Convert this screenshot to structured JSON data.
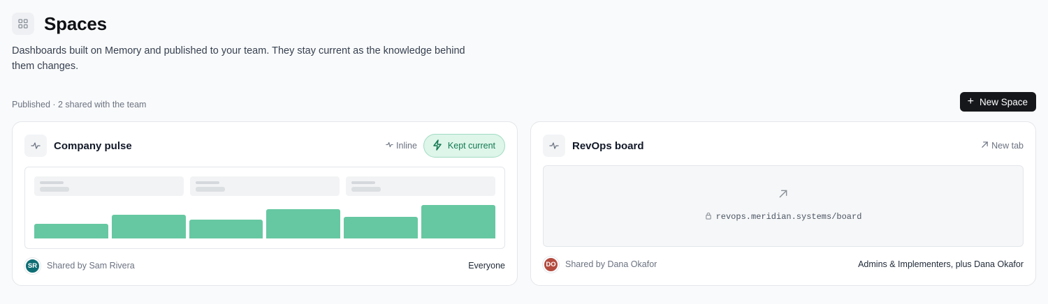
{
  "header": {
    "icon": "grid-icon",
    "title": "Spaces",
    "description": "Dashboards built on Memory and published to your team. They stay current as the knowledge behind them changes."
  },
  "section": {
    "label": "Published · 2 shared with the team",
    "new_button_label": "New Space"
  },
  "spaces": [
    {
      "title": "Company pulse",
      "icon": "pulse-icon",
      "mode": "Inline",
      "badge": "Kept current",
      "preview": {
        "kpi_count": 3,
        "bar_values": [
          0.43,
          0.7,
          0.56,
          0.88,
          0.65,
          1.0
        ],
        "bar_color": "#66c8a2"
      },
      "shared_by": "Shared by Sam Rivera",
      "avatar_initials": "SR",
      "avatar_color": "#0e6e74",
      "audience": "Everyone"
    },
    {
      "title": "RevOps board",
      "icon": "pulse-icon",
      "mode": "New tab",
      "url": "revops.meridian.systems/board",
      "shared_by": "Shared by Dana Okafor",
      "avatar_initials": "DO",
      "avatar_color": "#b44b3f",
      "audience": "Admins & Implementers, plus Dana Okafor"
    }
  ],
  "colors": {
    "accent_green": "#137a51",
    "button_dark": "#15171b"
  }
}
